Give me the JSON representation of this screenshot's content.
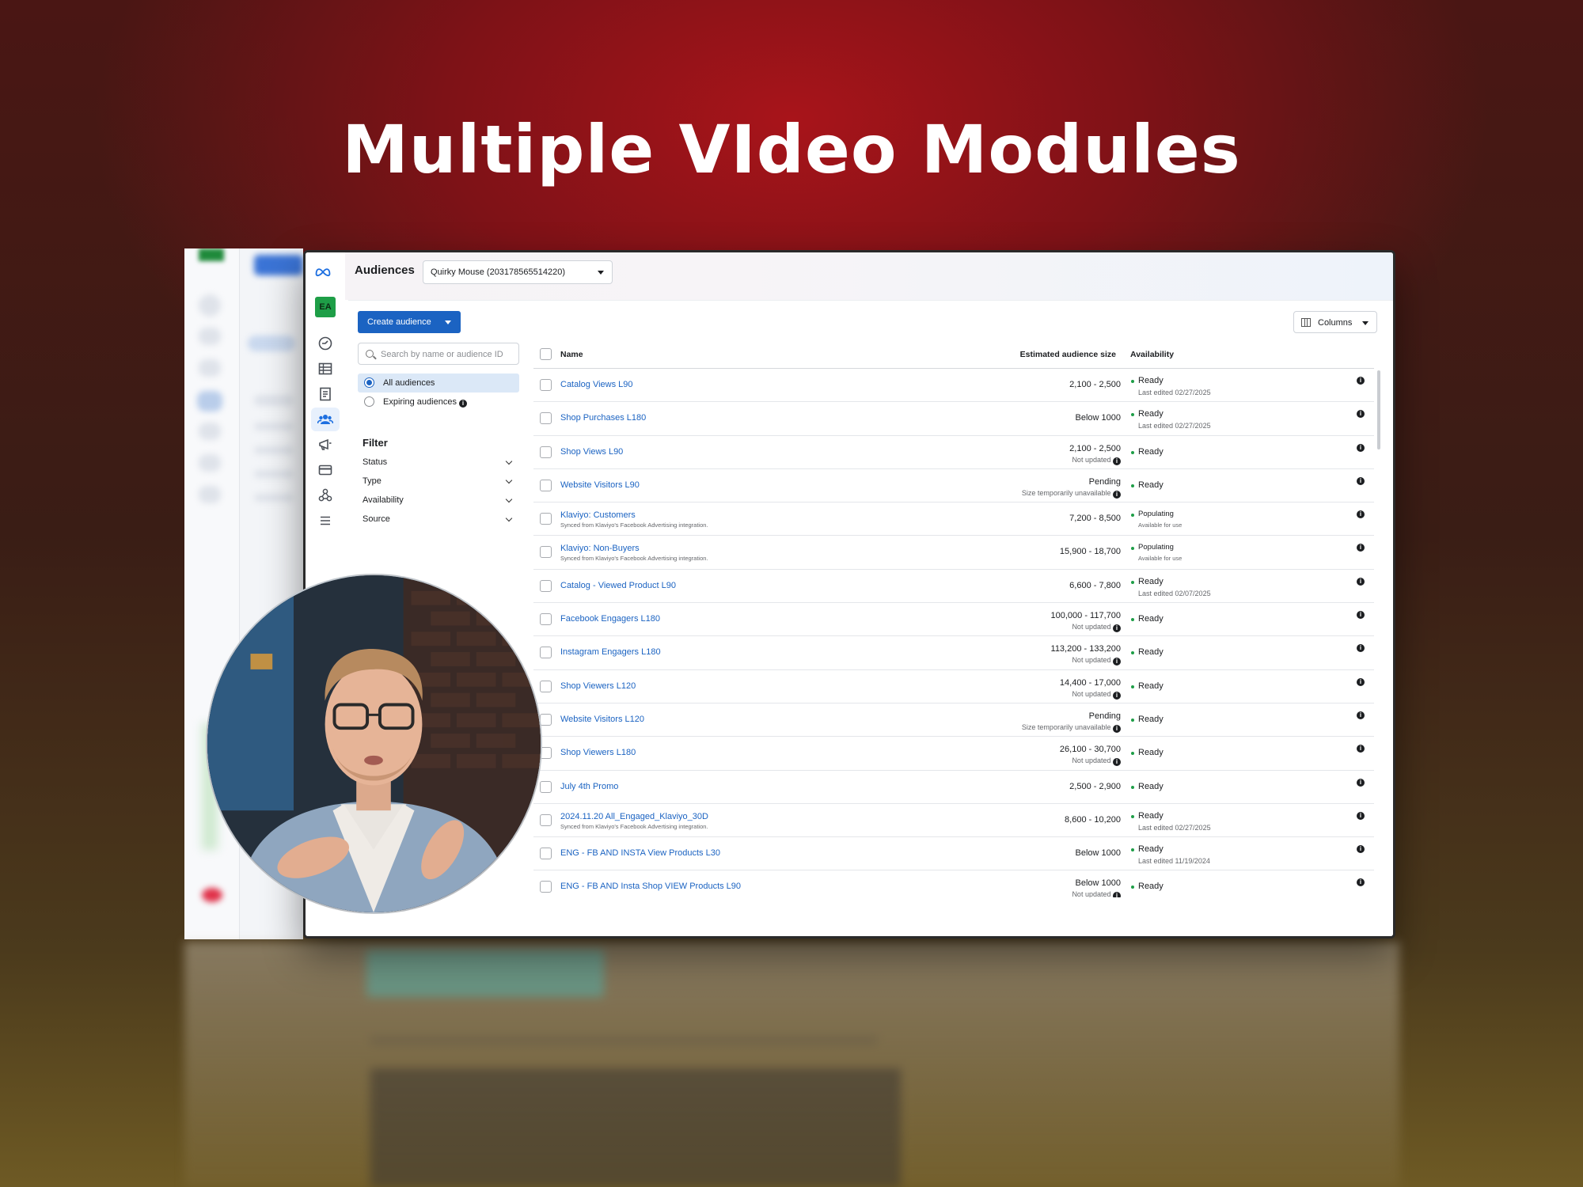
{
  "headline": "Multiple VIdeo Modules",
  "app": {
    "page_title": "Audiences",
    "account_selector": "Quirky Mouse (203178565514220)",
    "account_badge": "EA",
    "create_button": "Create audience",
    "columns_button": "Columns",
    "search_placeholder": "Search by name or audience ID",
    "views": [
      {
        "label": "All audiences",
        "selected": true
      },
      {
        "label": "Expiring audiences",
        "selected": false
      }
    ],
    "filter_title": "Filter",
    "filters": [
      "Status",
      "Type",
      "Availability",
      "Source"
    ],
    "table": {
      "headers": {
        "name": "Name",
        "size": "Estimated audience size",
        "availability": "Availability"
      },
      "rows": [
        {
          "name": "Catalog Views L90",
          "sub": "",
          "size": "2,100 - 2,500",
          "size_note": "",
          "availability": "Ready",
          "avail_note": "Last edited 02/27/2025"
        },
        {
          "name": "Shop Purchases L180",
          "sub": "",
          "size": "Below 1000",
          "size_note": "",
          "availability": "Ready",
          "avail_note": "Last edited 02/27/2025"
        },
        {
          "name": "Shop Views L90",
          "sub": "",
          "size": "2,100 - 2,500",
          "size_note": "Not updated",
          "availability": "Ready",
          "avail_note": ""
        },
        {
          "name": "Website Visitors L90",
          "sub": "",
          "size": "Pending",
          "size_note": "Size temporarily unavailable",
          "availability": "Ready",
          "avail_note": ""
        },
        {
          "name": "Klaviyo: Customers",
          "sub": "Synced from Klaviyo's Facebook Advertising integration.",
          "size": "7,200 - 8,500",
          "size_note": "",
          "availability": "Populating",
          "avail_note": "Available for use"
        },
        {
          "name": "Klaviyo: Non-Buyers",
          "sub": "Synced from Klaviyo's Facebook Advertising integration.",
          "size": "15,900 - 18,700",
          "size_note": "",
          "availability": "Populating",
          "avail_note": "Available for use"
        },
        {
          "name": "Catalog - Viewed Product L90",
          "sub": "",
          "size": "6,600 - 7,800",
          "size_note": "",
          "availability": "Ready",
          "avail_note": "Last edited 02/07/2025"
        },
        {
          "name": "Facebook Engagers L180",
          "sub": "",
          "size": "100,000 - 117,700",
          "size_note": "Not updated",
          "availability": "Ready",
          "avail_note": ""
        },
        {
          "name": "Instagram Engagers L180",
          "sub": "",
          "size": "113,200 - 133,200",
          "size_note": "Not updated",
          "availability": "Ready",
          "avail_note": ""
        },
        {
          "name": "Shop Viewers L120",
          "sub": "",
          "size": "14,400 - 17,000",
          "size_note": "Not updated",
          "availability": "Ready",
          "avail_note": ""
        },
        {
          "name": "Website Visitors L120",
          "sub": "",
          "size": "Pending",
          "size_note": "Size temporarily unavailable",
          "availability": "Ready",
          "avail_note": ""
        },
        {
          "name": "Shop Viewers L180",
          "sub": "",
          "size": "26,100 - 30,700",
          "size_note": "Not updated",
          "availability": "Ready",
          "avail_note": ""
        },
        {
          "name": "July 4th Promo",
          "sub": "",
          "size": "2,500 - 2,900",
          "size_note": "",
          "availability": "Ready",
          "avail_note": ""
        },
        {
          "name": "2024.11.20 All_Engaged_Klaviyo_30D",
          "sub": "Synced from Klaviyo's Facebook Advertising integration.",
          "size": "8,600 - 10,200",
          "size_note": "",
          "availability": "Ready",
          "avail_note": "Last edited 02/27/2025"
        },
        {
          "name": "ENG - FB AND INSTA View Products L30",
          "sub": "",
          "size": "Below 1000",
          "size_note": "",
          "availability": "Ready",
          "avail_note": "Last edited 11/19/2024"
        },
        {
          "name": "ENG - FB AND Insta Shop VIEW Products L90",
          "sub": "",
          "size": "Below 1000",
          "size_note": "Not updated",
          "availability": "Ready",
          "avail_note": ""
        }
      ]
    }
  },
  "colors": {
    "accent": "#1b63c2",
    "status_green": "#1e9e47",
    "badge_green": "#1e9e47"
  }
}
